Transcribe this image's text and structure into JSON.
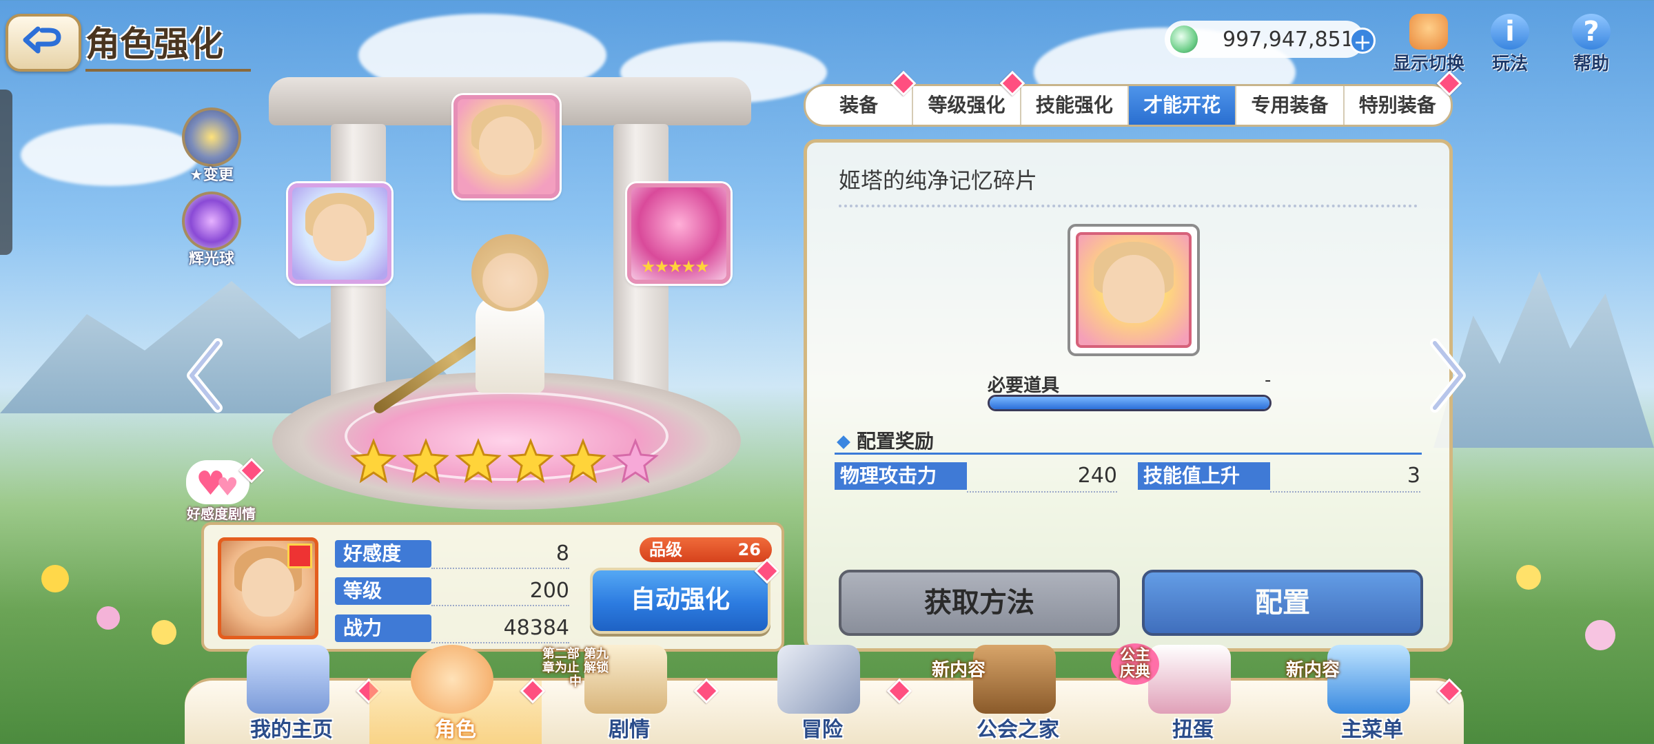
{
  "header": {
    "title": "角色强化"
  },
  "currency": {
    "jewels": "997,947,851",
    "plus": "+"
  },
  "top_buttons": [
    {
      "label": "显示切换"
    },
    {
      "label": "玩法"
    },
    {
      "label": "帮助"
    }
  ],
  "side_buttons": [
    {
      "label": "★变更"
    },
    {
      "label": "辉光球"
    }
  ],
  "affinity_button": {
    "label": "好感度剧情"
  },
  "rarity": {
    "stars": 6,
    "filled": 5
  },
  "stats": {
    "rows": [
      {
        "label": "好感度",
        "value": "8"
      },
      {
        "label": "等级",
        "value": "200"
      },
      {
        "label": "战力",
        "value": "48384"
      }
    ],
    "rank_label": "品级",
    "rank_value": "26",
    "auto_enhance": "自动强化"
  },
  "tabs": [
    {
      "label": "装备",
      "active": false
    },
    {
      "label": "等级强化",
      "active": false
    },
    {
      "label": "技能强化",
      "active": false
    },
    {
      "label": "才能开花",
      "active": true
    },
    {
      "label": "专用装备",
      "active": false
    },
    {
      "label": "特别装备",
      "active": false
    }
  ],
  "panel": {
    "item_name": "姬塔的纯净记忆碎片",
    "required_label": "必要道具",
    "required_value": "-",
    "required_progress": 1.0,
    "reward_heading": "配置奖励",
    "rewards": [
      {
        "label": "物理攻击力",
        "value": "240"
      },
      {
        "label": "技能值上升",
        "value": "3"
      }
    ],
    "obtain_button": "获取方法",
    "equip_button": "配置"
  },
  "bottom_nav": [
    {
      "label": "我的主页",
      "badge": ""
    },
    {
      "label": "角色",
      "badge": "",
      "active": true
    },
    {
      "label": "剧情",
      "badge": "第二部 第九章为止 解锁中"
    },
    {
      "label": "冒险",
      "badge": ""
    },
    {
      "label": "公会之家",
      "badge": "新内容"
    },
    {
      "label": "扭蛋",
      "badge": "公主庆典"
    },
    {
      "label": "主菜单",
      "badge": "新内容"
    }
  ],
  "colors": {
    "accent_blue": "#2c7be0",
    "tab_active": "#2a6fd0",
    "notify_pink": "#ff4f80",
    "rank_orange": "#e45d1e"
  }
}
